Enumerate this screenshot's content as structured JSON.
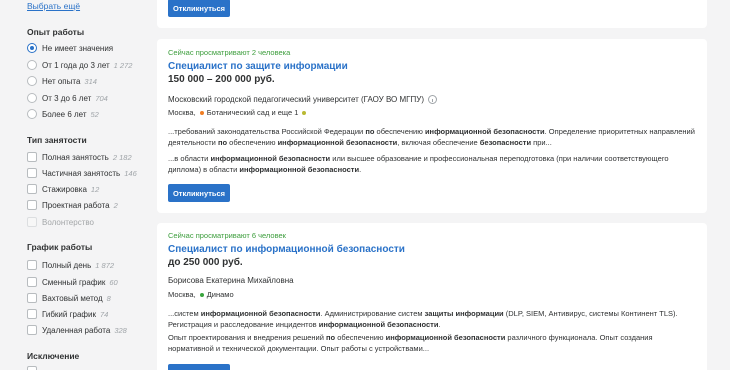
{
  "sidebar": {
    "show_more": "Выбрать ещё",
    "experience": {
      "title": "Опыт работы",
      "options": [
        {
          "label": "Не имеет значения",
          "count": "",
          "checked": true
        },
        {
          "label": "От 1 года до 3 лет",
          "count": "1 272",
          "checked": false
        },
        {
          "label": "Нет опыта",
          "count": "314",
          "checked": false
        },
        {
          "label": "От 3 до 6 лет",
          "count": "704",
          "checked": false
        },
        {
          "label": "Более 6 лет",
          "count": "52",
          "checked": false
        }
      ]
    },
    "employment": {
      "title": "Тип занятости",
      "options": [
        {
          "label": "Полная занятость",
          "count": "2 182"
        },
        {
          "label": "Частичная занятость",
          "count": "146"
        },
        {
          "label": "Стажировка",
          "count": "12"
        },
        {
          "label": "Проектная работа",
          "count": "2"
        },
        {
          "label": "Волонтерство",
          "count": ""
        }
      ]
    },
    "schedule": {
      "title": "График работы",
      "options": [
        {
          "label": "Полный день",
          "count": "1 872"
        },
        {
          "label": "Сменный график",
          "count": "60"
        },
        {
          "label": "Вахтовый метод",
          "count": "8"
        },
        {
          "label": "Гибкий график",
          "count": "74"
        },
        {
          "label": "Удаленная работа",
          "count": "328"
        }
      ]
    },
    "exclusion": {
      "title": "Исключение"
    }
  },
  "respond_label": "Откликнуться",
  "vacancies": [
    {
      "viewers": "Сейчас просматривают 2 человека",
      "title": "Специалист по защите информации",
      "salary": "150 000 – 200 000 руб.",
      "employer": "Московский городской педагогический университет (ГАОУ ВО МГПУ)",
      "city": "Москва,",
      "metro": "Ботанический сад и еще 1",
      "metro_color": "#f07e24",
      "metro_color_2": "#b9b933",
      "responsibility": "...требований законодательства Российской Федерации <b>по</b> обеспечению <b>информационной безопасности</b>. Определение приоритетных направлений деятельности <b>по</b> обеспечению <b>информационной безопасности</b>, включая обеспечение <b>безопасности</b> при...",
      "requirement": "...в области <b>информационной безопасности</b> или высшее образование и профессиональная переподготовка (при наличии соответствующего диплома) в области <b>информационной безопасности</b>."
    },
    {
      "viewers": "Сейчас просматривают 6 человек",
      "title": "Специалист по информационной безопасности",
      "salary": "до 250 000 руб.",
      "employer": "Борисова Екатерина Михайловна",
      "city": "Москва,",
      "metro": "Динамо",
      "metro_color": "#3aa53f",
      "responsibility": "...систем <b>информационной безопасности</b>. Администрирование систем <b>защиты информации</b> (DLP, SIEM, Антивирус, системы Континент TLS). Регистрация и расследование инцидентов <b>информационной безопасности</b>.",
      "requirement": "Опыт проектирования и внедрения решений <b>по</b> обеспечению <b>информационной безопасности</b> различного функционала. Опыт создания нормативной и технической документации. Опыт работы с устройствами..."
    }
  ]
}
